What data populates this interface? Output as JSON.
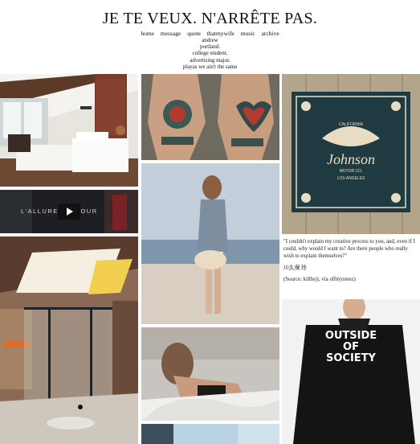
{
  "blog": {
    "title": "JE TE VEUX. N'ARRÊTE PAS.",
    "nav": [
      "home",
      "message",
      "quote",
      "thatmywife",
      "music",
      "archive"
    ],
    "bio": [
      "andrew",
      "portland.",
      "college student.",
      "advertising major.",
      "playas we ain't the same"
    ]
  },
  "posts": {
    "video_title": "L'ALLURE D'AMOUR",
    "bandana_text": [
      "CALIFORNIA",
      "Johnson",
      "MOTOR CO.",
      "LOS ANGELES"
    ],
    "quote": {
      "text": "\"I couldn't explain my creative process to you, and, even if I could, why would I want to? Are there people who really wish to explain themselves?\"",
      "author": "川久保 玲",
      "source": "(Source: killheji, via offmysteez)"
    },
    "jacket_text": [
      "OUTSIDE",
      "OF",
      "SOCIETY"
    ]
  },
  "colors": {
    "background": "#ffffff",
    "text": "#111111"
  }
}
